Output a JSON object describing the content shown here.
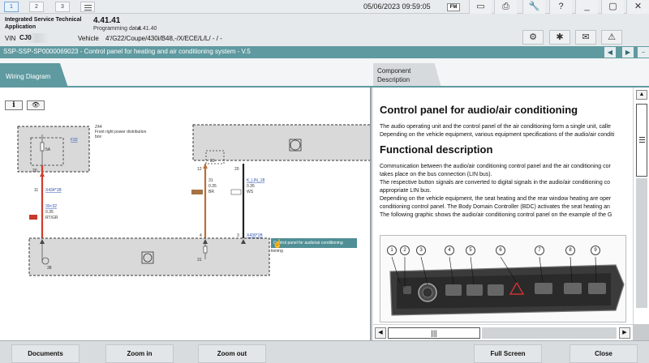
{
  "topbar": {
    "nav": [
      "1",
      "2",
      "3"
    ],
    "datetime": "05/06/2023 09:59:05",
    "fm_label": "FM",
    "icons": [
      "window-icon",
      "printer-icon",
      "wrench-icon",
      "help-icon",
      "minimize-icon",
      "close-icon"
    ]
  },
  "info": {
    "app_label": "Integrated Service Technical Application",
    "app_version": "4.41.41",
    "prog_label": "Programming data:",
    "prog_value": "4.41.40",
    "vin_label": "VIN",
    "vin_value": "CJ0",
    "vehicle_label": "Vehicle",
    "vehicle_value": "4'/G22/Coupe/430i/B48,-/X/ECE/L/L/ - / -",
    "icons": [
      "tools-icon",
      "settings-icon",
      "mail-icon",
      "warning-icon"
    ]
  },
  "titlebar": {
    "title": "SSP-SSP-SP0000069023 - Control panel for heating and air conditioning system - V.5"
  },
  "tabs": {
    "wiring": "Wiring Diagram",
    "component": "Component Description"
  },
  "wiring": {
    "z44": "Z44",
    "z44_desc1": "Front right power distribution",
    "z44_desc2": "box",
    "f32": "F32",
    "fuse_rating": "5A",
    "pin_20": "20",
    "pin_11": "11",
    "x434": "X434*1B",
    "wire1_spec": "30<32",
    "wire1_size": "0.35",
    "wire1_color": "RT/GR",
    "pin_12": "12",
    "pin_31a": "31",
    "w2_num": "31",
    "w2_size": "0.35",
    "w2_color": "BR",
    "pin_20b": "20",
    "klin": "K_LIN_18",
    "klin_size": "0.35",
    "klin_color": "WS",
    "pin_4": "4",
    "pin_3": "3",
    "x439": "X439*1B",
    "pin_38": "38",
    "pin_31b": "31"
  },
  "tooltip": "Control panel for audio/air conditioning",
  "tooltip_tail": "tioning",
  "doc": {
    "h1": "Control panel for audio/air conditioning",
    "p1": [
      "The audio operating unit and the control panel of the air conditioning form a single unit, calle",
      "Depending on the vehicle equipment, various equipment specifications of the audio/air conditi"
    ],
    "h2": "Functional description",
    "p2": [
      "Communication between the audio/air conditioning control panel and the air conditioning cor",
      "takes place on the bus connection (LIN bus).",
      "The respective button signals are converted to digital signals in the audio/air conditioning co",
      "appropriate LIN bus.",
      "Depending on the vehicle equipment, the seat heating and the rear window heating are oper",
      "conditioning control panel. The Body Domain Controller (BDC) activates the seat heating an",
      "The following graphic shows the audio/air conditioning control panel on the example of the G"
    ],
    "callouts": [
      "1",
      "2",
      "3",
      "4",
      "5",
      "6",
      "7",
      "8",
      "9"
    ]
  },
  "bottom": {
    "documents": "Documents",
    "zoom_in": "Zoom in",
    "zoom_out": "Zoom out",
    "full_screen": "Full Screen",
    "close": "Close"
  },
  "colors": {
    "teal": "#5f9aa0",
    "wire_red": "#d33b2b",
    "wire_brown": "#b7703a",
    "wire_white": "#222222"
  }
}
